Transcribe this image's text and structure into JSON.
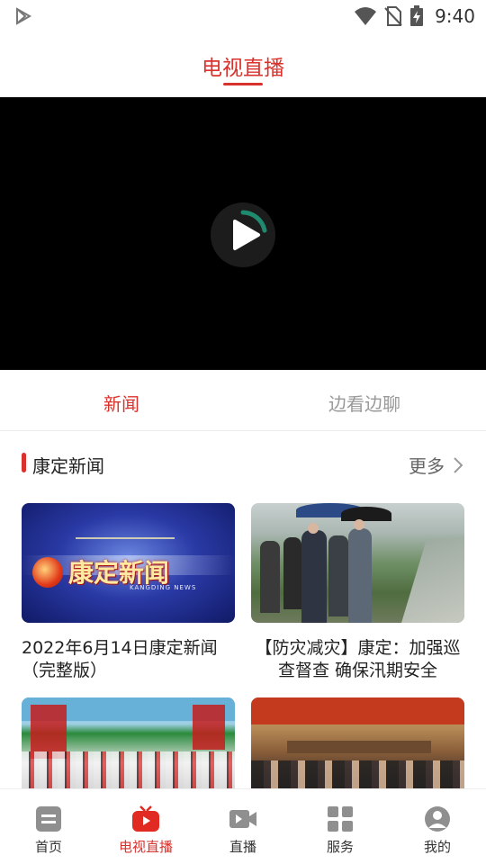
{
  "status_bar": {
    "time": "9:40",
    "icons": [
      "play-store-icon",
      "wifi-icon",
      "no-sim-icon",
      "battery-charging-icon"
    ]
  },
  "header": {
    "title": "电视直播"
  },
  "player": {
    "control_icon": "play-icon"
  },
  "subtabs": [
    {
      "label": "新闻",
      "active": true
    },
    {
      "label": "边看边聊",
      "active": false
    }
  ],
  "section": {
    "title": "康定新闻",
    "more_label": "更多"
  },
  "cards": [
    {
      "title": "2022年6月14日康定新闻（完整版）",
      "thumb_text": "康定新闻",
      "thumb_subtext": "KANGDING NEWS"
    },
    {
      "title": "【防灾减灾】康定：加强巡查督查 确保汛期安全"
    },
    {
      "title": ""
    },
    {
      "title": ""
    }
  ],
  "tabbar": [
    {
      "label": "首页",
      "icon": "home-icon",
      "active": false
    },
    {
      "label": "电视直播",
      "icon": "tv-icon",
      "active": true
    },
    {
      "label": "直播",
      "icon": "video-camera-icon",
      "active": false
    },
    {
      "label": "服务",
      "icon": "grid-icon",
      "active": false
    },
    {
      "label": "我的",
      "icon": "profile-icon",
      "active": false
    }
  ],
  "colors": {
    "accent": "#d9322d",
    "video_bg": "#000000",
    "inactive_tab": "#999999"
  }
}
